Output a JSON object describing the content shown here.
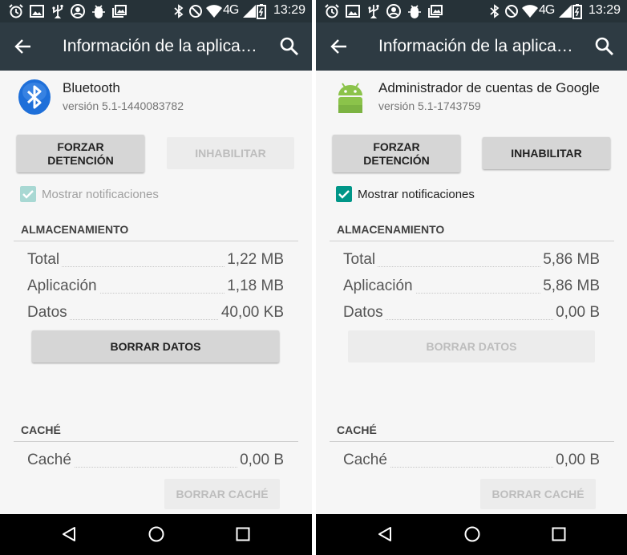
{
  "status_bar": {
    "time": "13:29",
    "network": "4G",
    "icons": [
      "alarm-icon",
      "image-icon",
      "usb-icon",
      "account-circle-icon",
      "android-debug-icon",
      "photo-gallery-icon",
      "bluetooth-icon",
      "do-not-disturb-icon",
      "wifi-icon",
      "signal-icon",
      "battery-icon"
    ]
  },
  "left": {
    "appbar_title": "Información de la aplica…",
    "app_name": "Bluetooth",
    "app_version": "versión 5.1-1440083782",
    "force_stop": "FORZAR DETENCIÓN",
    "disable": "INHABILITAR",
    "disable_enabled": false,
    "show_notifications": "Mostrar notificaciones",
    "notifications_checked": true,
    "notifications_enabled": false,
    "storage_title": "ALMACENAMIENTO",
    "storage_rows": [
      {
        "label": "Total",
        "value": "1,22 MB"
      },
      {
        "label": "Aplicación",
        "value": "1,18 MB"
      },
      {
        "label": "Datos",
        "value": "40,00 KB"
      }
    ],
    "clear_data": "BORRAR DATOS",
    "clear_data_enabled": true,
    "cache_title": "CACHÉ",
    "cache_row": {
      "label": "Caché",
      "value": "0,00 B"
    },
    "clear_cache": "BORRAR CACHÉ",
    "clear_cache_enabled": false
  },
  "right": {
    "appbar_title": "Información de la aplica…",
    "app_name": "Administrador de cuentas de Google",
    "app_version": "versión 5.1-1743759",
    "force_stop": "FORZAR DETENCIÓN",
    "disable": "INHABILITAR",
    "disable_enabled": true,
    "show_notifications": "Mostrar notificaciones",
    "notifications_checked": true,
    "notifications_enabled": true,
    "storage_title": "ALMACENAMIENTO",
    "storage_rows": [
      {
        "label": "Total",
        "value": "5,86 MB"
      },
      {
        "label": "Aplicación",
        "value": "5,86 MB"
      },
      {
        "label": "Datos",
        "value": "0,00 B"
      }
    ],
    "clear_data": "BORRAR DATOS",
    "clear_data_enabled": false,
    "cache_title": "CACHÉ",
    "cache_row": {
      "label": "Caché",
      "value": "0,00 B"
    },
    "clear_cache": "BORRAR CACHÉ",
    "clear_cache_enabled": false
  },
  "colors": {
    "status_bar": "#263238",
    "app_bar": "#2e3b43",
    "accent": "#009688",
    "accent_disabled": "#a8d8d3",
    "bluetooth_blue": "#1e6fd9",
    "android_green": "#8bc34a"
  },
  "nav_icons": [
    "back-triangle-icon",
    "home-circle-icon",
    "recents-square-icon"
  ]
}
